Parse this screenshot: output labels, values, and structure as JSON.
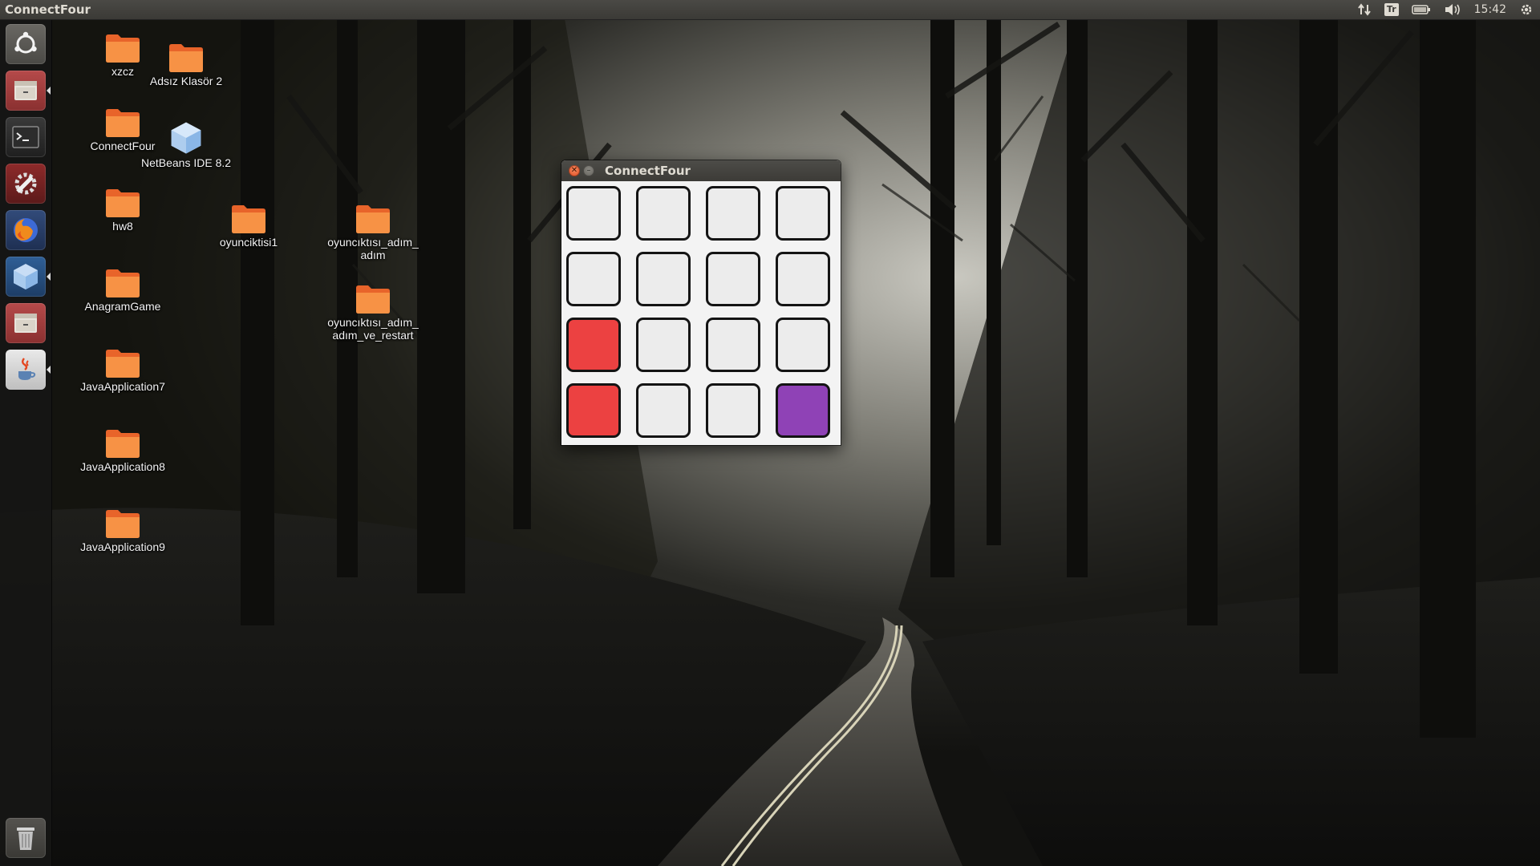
{
  "top_panel": {
    "app_title": "ConnectFour",
    "keyboard_layout": "Tr",
    "clock": "15:42",
    "indicator_icons": [
      "network-arrows-icon",
      "keyboard-layout-icon",
      "battery-icon",
      "volume-icon",
      "settings-gear-icon"
    ]
  },
  "launcher": {
    "items": [
      {
        "name": "dash-home",
        "icon": "ubuntu-logo-icon"
      },
      {
        "name": "files",
        "icon": "file-cabinet-icon"
      },
      {
        "name": "terminal",
        "icon": "terminal-icon"
      },
      {
        "name": "system-settings",
        "icon": "settings-wrench-icon"
      },
      {
        "name": "firefox",
        "icon": "firefox-icon"
      },
      {
        "name": "netbeans",
        "icon": "netbeans-cube-icon"
      },
      {
        "name": "files-2",
        "icon": "file-cabinet-icon"
      },
      {
        "name": "java",
        "icon": "java-cup-icon"
      },
      {
        "name": "trash",
        "icon": "trash-icon"
      }
    ]
  },
  "desktop": {
    "icons": [
      {
        "label": "xzcz",
        "type": "folder"
      },
      {
        "label": "Adsız Klasör 2",
        "type": "folder"
      },
      {
        "label": "ConnectFour",
        "type": "folder"
      },
      {
        "label": "NetBeans IDE 8.2",
        "type": "netbeans"
      },
      {
        "label": "hw8",
        "type": "folder"
      },
      {
        "label": "oyunciktisi1",
        "type": "folder"
      },
      {
        "label": "oyuncıktısı_adım_\nadım",
        "type": "folder"
      },
      {
        "label": "AnagramGame",
        "type": "folder"
      },
      {
        "label": "oyuncıktısı_adım_\nadım_ve_restart",
        "type": "folder"
      },
      {
        "label": "JavaApplication7",
        "type": "folder"
      },
      {
        "label": "JavaApplication8",
        "type": "folder"
      },
      {
        "label": "JavaApplication9",
        "type": "folder"
      }
    ]
  },
  "window": {
    "title": "ConnectFour",
    "board": {
      "rows": 4,
      "cols": 4,
      "cells": [
        [
          "empty",
          "empty",
          "empty",
          "empty"
        ],
        [
          "empty",
          "empty",
          "empty",
          "empty"
        ],
        [
          "red",
          "empty",
          "empty",
          "empty"
        ],
        [
          "red",
          "empty",
          "empty",
          "purple"
        ]
      ]
    }
  },
  "colors": {
    "red_piece": "#ec4141",
    "purple_piece": "#8f42b6",
    "empty_cell": "#ececec",
    "panel": "#3c3b37",
    "close_button": "#e0481e"
  }
}
